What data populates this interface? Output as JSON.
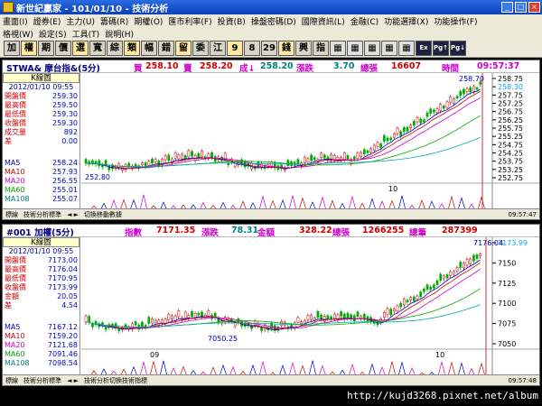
{
  "window": {
    "title": "新世紀贏家 - 101/01/10 - 技術分析"
  },
  "menus": {
    "row1": [
      "畫面(I)",
      "證券(E)",
      "主力(U)",
      "籌碼(R)",
      "期權(O)",
      "匯市利率(F)",
      "投資(B)",
      "操盤密碼(D)",
      "國際資訊(L)",
      "金融(C)",
      "功能選擇(X)",
      "功能操作(F)"
    ],
    "row2": [
      "格視(W)",
      "設定(S)",
      "工具(T)",
      "說明(H)"
    ]
  },
  "toolbar": [
    "加",
    "權",
    "期",
    "價",
    "選",
    "寬",
    "綜",
    "類",
    "幅",
    "錯",
    "留",
    "委",
    "江",
    "9",
    "8",
    "29",
    "錢",
    "興",
    "指"
  ],
  "panel1": {
    "quote": {
      "name": "STWA& 摩台指&(5分)",
      "buy_label": "買",
      "buy": "258.10",
      "sell_label": "賣",
      "sell": "258.20",
      "deal_label": "成↓",
      "deal": "258.20",
      "chg_label": "漲跌",
      "chg": "3.70",
      "vol_label": "總張",
      "vol": "16607",
      "time_label": "時間",
      "time": "09:57:37"
    },
    "info": {
      "kbox": "K線圖",
      "date": "2012/01/10 09:55",
      "rows": [
        {
          "k": "開盤價",
          "v": "259.30"
        },
        {
          "k": "最高價",
          "v": "259.50"
        },
        {
          "k": "最低價",
          "v": "259.30"
        },
        {
          "k": "收盤價",
          "v": "259.30"
        },
        {
          "k": "成交量",
          "v": "892"
        },
        {
          "k": "差",
          "v": "0.00"
        }
      ],
      "ma": [
        {
          "k": "MA5",
          "v": "258.24"
        },
        {
          "k": "MA10",
          "v": "257.93"
        },
        {
          "k": "MA20",
          "v": "256.55"
        },
        {
          "k": "MA60",
          "v": "255.01"
        },
        {
          "k": "MA108",
          "v": "255.07"
        }
      ]
    },
    "chart": {
      "yticks": [
        "258.75",
        "258.30",
        "257.75",
        "257.25",
        "256.75",
        "256.25",
        "255.75",
        "255.25",
        "254.75",
        "254.25",
        "253.75",
        "253.25",
        "252.75"
      ],
      "high_label": "258.70",
      "low_label": "252.80",
      "last_label": "258.30",
      "x_label": "10"
    },
    "status": [
      "標線",
      "技術分析標準",
      "◄ ►",
      "切換移動數據",
      "09:57:47"
    ]
  },
  "panel2": {
    "quote": {
      "name": "#001 加權(5分)",
      "idx_label": "指數",
      "idx": "7171.35",
      "chg_label": "漲跌",
      "chg": "78.31",
      "amt_label": "金額",
      "amt": "328.22",
      "vol_label": "總張",
      "vol": "1266255",
      "cnt_label": "總筆",
      "cnt": "287399"
    },
    "info": {
      "kbox": "K線圖",
      "date": "2012/01/10 09:55",
      "rows": [
        {
          "k": "開盤價",
          "v": "7173.00"
        },
        {
          "k": "最高價",
          "v": "7176.04"
        },
        {
          "k": "最低價",
          "v": "7170.95"
        },
        {
          "k": "收盤價",
          "v": "7173.99"
        },
        {
          "k": "金額",
          "v": "20.05"
        },
        {
          "k": "差",
          "v": "4.54"
        }
      ],
      "ma": [
        {
          "k": "MA5",
          "v": "7167.12"
        },
        {
          "k": "MA10",
          "v": "7159.20"
        },
        {
          "k": "MA20",
          "v": "7121.68"
        },
        {
          "k": "MA60",
          "v": "7091.46"
        },
        {
          "k": "MA108",
          "v": "7098.54"
        }
      ]
    },
    "chart": {
      "yticks": [
        "7173.99",
        "7150",
        "7125",
        "7100",
        "7075",
        "7050"
      ],
      "high_label": "7176.04",
      "low_label": "7050.25",
      "x_label1": "09",
      "x_label2": "10"
    },
    "status": [
      "標線",
      "技術分析標準",
      "◄ ►",
      "技術分析切換技術指標",
      "09:57:48"
    ]
  },
  "watermark": "http://kujd3268.pixnet.net/album"
}
